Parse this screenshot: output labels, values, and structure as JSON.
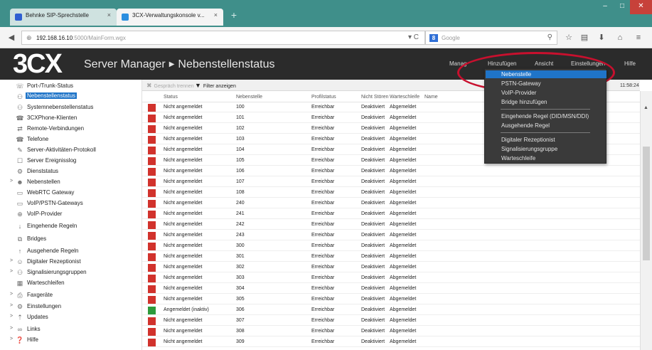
{
  "browser": {
    "tabs": [
      {
        "label": "Behnke SIP-Sprechstelle",
        "favicon_color": "#2f5fd1"
      },
      {
        "label": "3CX-Verwaltungskonsole v...",
        "favicon_color": "#2b8ee0"
      }
    ],
    "url_host": "192.168.16.10",
    "url_path": ":5000/MainForm.wgx",
    "search_placeholder": "Google"
  },
  "header": {
    "logo": "3CX",
    "breadcrumb_root": "Server Manager",
    "breadcrumb_page": "Nebenstellenstatus",
    "menu": [
      "Manag",
      "Hinzufügen",
      "Ansicht",
      "Einstellungen",
      "Hilfe"
    ]
  },
  "sidebar": {
    "items": [
      {
        "label": "Port-/Trunk-Status",
        "expand": ""
      },
      {
        "label": "Nebenstellenstatus",
        "expand": "",
        "active": true
      },
      {
        "label": "Systemnebenstellenstatus",
        "expand": ""
      },
      {
        "label": "3CXPhone-Klienten",
        "expand": ""
      },
      {
        "label": "Remote-Verbindungen",
        "expand": ""
      },
      {
        "label": "Telefone",
        "expand": ""
      },
      {
        "label": "Server-Aktivitäten-Protokoll",
        "expand": ""
      },
      {
        "label": "Server Ereignisslog",
        "expand": ""
      },
      {
        "label": "Dienststatus",
        "expand": ""
      },
      {
        "label": "Nebenstellen",
        "expand": ">"
      },
      {
        "label": "WebRTC Gateway",
        "expand": ""
      },
      {
        "label": "VoIP/PSTN-Gateways",
        "expand": ""
      },
      {
        "label": "VoIP-Provider",
        "expand": ""
      },
      {
        "label": "Eingehende Regeln",
        "expand": ""
      },
      {
        "label": "Bridges",
        "expand": ""
      },
      {
        "label": "Ausgehende Regeln",
        "expand": ""
      },
      {
        "label": "Digitaler Rezeptionist",
        "expand": ">"
      },
      {
        "label": "Signalisierungsgruppen",
        "expand": ">"
      },
      {
        "label": "Warteschleifen",
        "expand": ""
      },
      {
        "label": "Faxgeräte",
        "expand": ">"
      },
      {
        "label": "Einstellungen",
        "expand": ">"
      },
      {
        "label": "Updates",
        "expand": ">"
      },
      {
        "label": "Links",
        "expand": ">"
      },
      {
        "label": "Hilfe",
        "expand": ">"
      }
    ]
  },
  "toolbar": {
    "disconnect_label": "Gespräch trennen",
    "filter_label": "Filter anzeigen",
    "time": "11:58:24"
  },
  "table": {
    "headers": [
      "Status",
      "Nebenstelle",
      "Profilstatus",
      "Nicht Stören",
      "Warteschleife",
      "Name"
    ],
    "rows": [
      {
        "status": "Nicht angemeldet",
        "ext": "100",
        "profile": "Erreichbar",
        "dnd": "Deaktiviert",
        "queue": "Abgemeldet",
        "ok": false
      },
      {
        "status": "Nicht angemeldet",
        "ext": "101",
        "profile": "Erreichbar",
        "dnd": "Deaktiviert",
        "queue": "Abgemeldet",
        "ok": false
      },
      {
        "status": "Nicht angemeldet",
        "ext": "102",
        "profile": "Erreichbar",
        "dnd": "Deaktiviert",
        "queue": "Abgemeldet",
        "ok": false
      },
      {
        "status": "Nicht angemeldet",
        "ext": "103",
        "profile": "Erreichbar",
        "dnd": "Deaktiviert",
        "queue": "Abgemeldet",
        "ok": false
      },
      {
        "status": "Nicht angemeldet",
        "ext": "104",
        "profile": "Erreichbar",
        "dnd": "Deaktiviert",
        "queue": "Abgemeldet",
        "ok": false
      },
      {
        "status": "Nicht angemeldet",
        "ext": "105",
        "profile": "Erreichbar",
        "dnd": "Deaktiviert",
        "queue": "Abgemeldet",
        "ok": false
      },
      {
        "status": "Nicht angemeldet",
        "ext": "106",
        "profile": "Erreichbar",
        "dnd": "Deaktiviert",
        "queue": "Abgemeldet",
        "ok": false
      },
      {
        "status": "Nicht angemeldet",
        "ext": "107",
        "profile": "Erreichbar",
        "dnd": "Deaktiviert",
        "queue": "Abgemeldet",
        "ok": false
      },
      {
        "status": "Nicht angemeldet",
        "ext": "108",
        "profile": "Erreichbar",
        "dnd": "Deaktiviert",
        "queue": "Abgemeldet",
        "ok": false
      },
      {
        "status": "Nicht angemeldet",
        "ext": "240",
        "profile": "Erreichbar",
        "dnd": "Deaktiviert",
        "queue": "Abgemeldet",
        "ok": false
      },
      {
        "status": "Nicht angemeldet",
        "ext": "241",
        "profile": "Erreichbar",
        "dnd": "Deaktiviert",
        "queue": "Abgemeldet",
        "ok": false
      },
      {
        "status": "Nicht angemeldet",
        "ext": "242",
        "profile": "Erreichbar",
        "dnd": "Deaktiviert",
        "queue": "Abgemeldet",
        "ok": false
      },
      {
        "status": "Nicht angemeldet",
        "ext": "243",
        "profile": "Erreichbar",
        "dnd": "Deaktiviert",
        "queue": "Abgemeldet",
        "ok": false
      },
      {
        "status": "Nicht angemeldet",
        "ext": "300",
        "profile": "Erreichbar",
        "dnd": "Deaktiviert",
        "queue": "Abgemeldet",
        "ok": false
      },
      {
        "status": "Nicht angemeldet",
        "ext": "301",
        "profile": "Erreichbar",
        "dnd": "Deaktiviert",
        "queue": "Abgemeldet",
        "ok": false
      },
      {
        "status": "Nicht angemeldet",
        "ext": "302",
        "profile": "Erreichbar",
        "dnd": "Deaktiviert",
        "queue": "Abgemeldet",
        "ok": false
      },
      {
        "status": "Nicht angemeldet",
        "ext": "303",
        "profile": "Erreichbar",
        "dnd": "Deaktiviert",
        "queue": "Abgemeldet",
        "ok": false
      },
      {
        "status": "Nicht angemeldet",
        "ext": "304",
        "profile": "Erreichbar",
        "dnd": "Deaktiviert",
        "queue": "Abgemeldet",
        "ok": false
      },
      {
        "status": "Nicht angemeldet",
        "ext": "305",
        "profile": "Erreichbar",
        "dnd": "Deaktiviert",
        "queue": "Abgemeldet",
        "ok": false
      },
      {
        "status": "Angemeldet (inaktiv)",
        "ext": "306",
        "profile": "Erreichbar",
        "dnd": "Deaktiviert",
        "queue": "Abgemeldet",
        "ok": true
      },
      {
        "status": "Nicht angemeldet",
        "ext": "307",
        "profile": "Erreichbar",
        "dnd": "Deaktiviert",
        "queue": "Abgemeldet",
        "ok": false
      },
      {
        "status": "Nicht angemeldet",
        "ext": "308",
        "profile": "Erreichbar",
        "dnd": "Deaktiviert",
        "queue": "Abgemeldet",
        "ok": false
      },
      {
        "status": "Nicht angemeldet",
        "ext": "309",
        "profile": "Erreichbar",
        "dnd": "Deaktiviert",
        "queue": "Abgemeldet",
        "ok": false
      }
    ]
  },
  "dropdown": {
    "items": [
      {
        "label": "Nebenstelle",
        "highlighted": true
      },
      {
        "label": "PSTN-Gateway"
      },
      {
        "label": "VoIP-Provider"
      },
      {
        "label": "Bridge hinzufügen"
      },
      {
        "label": "Eingehende Regel (DID/MSN/DDI)"
      },
      {
        "label": "Ausgehende Regel"
      },
      {
        "label": "Digitaler Rezeptionist"
      },
      {
        "label": "Signalisierungsgruppe"
      },
      {
        "label": "Warteschleife"
      }
    ]
  },
  "colors": {
    "status_offline": "#d1322c",
    "status_online": "#2e9a3b",
    "highlight": "#1f74c8",
    "annotation": "#c8102e"
  }
}
